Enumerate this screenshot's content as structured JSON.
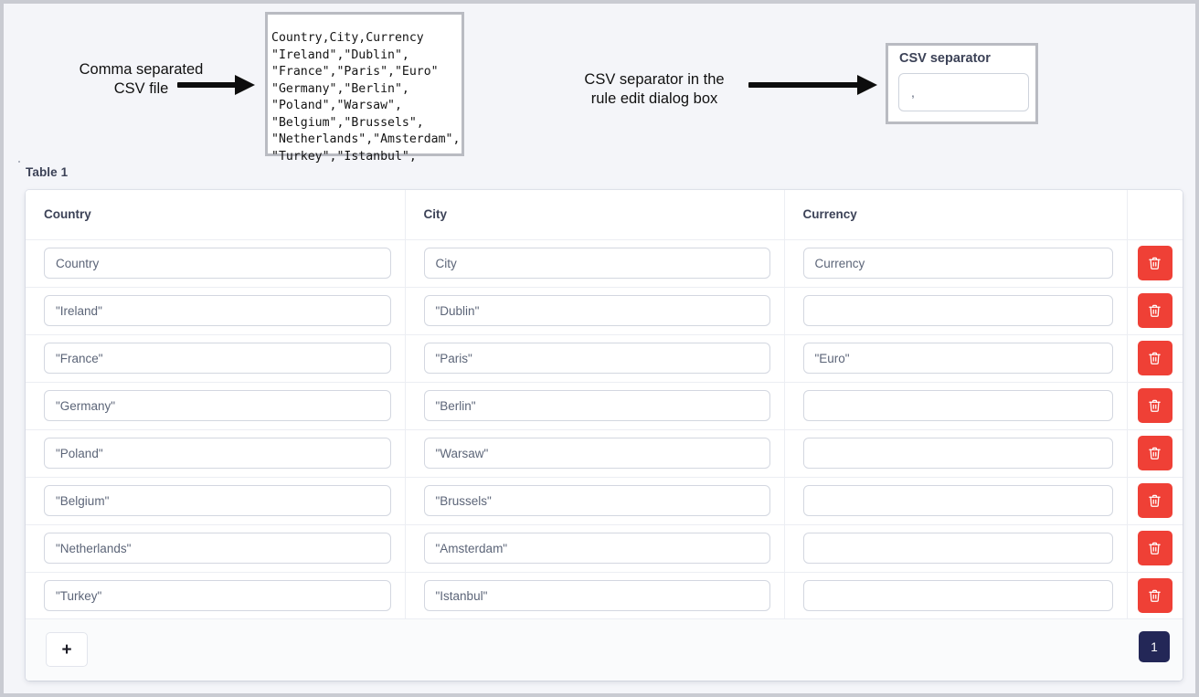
{
  "annotations": {
    "csv_file_label": "Comma separated\nCSV file",
    "separator_label": "CSV separator in the\nrule edit dialog box"
  },
  "csv_file": {
    "content": "Country,City,Currency\n\"Ireland\",\"Dublin\",\n\"France\",\"Paris\",\"Euro\"\n\"Germany\",\"Berlin\",\n\"Poland\",\"Warsaw\",\n\"Belgium\",\"Brussels\",\n\"Netherlands\",\"Amsterdam\",\n\"Turkey\",\"Istanbul\","
  },
  "separator_dialog": {
    "title": "CSV separator",
    "value": ","
  },
  "table": {
    "title": "Table 1",
    "columns": [
      "Country",
      "City",
      "Currency",
      ""
    ],
    "rows": [
      {
        "country": "Country",
        "city": "City",
        "currency": "Currency",
        "delete_label": "delete-row"
      },
      {
        "country": "\"Ireland\"",
        "city": "\"Dublin\"",
        "currency": "",
        "delete_label": "delete-row"
      },
      {
        "country": "\"France\"",
        "city": "\"Paris\"",
        "currency": "\"Euro\"",
        "delete_label": "delete-row"
      },
      {
        "country": "\"Germany\"",
        "city": "\"Berlin\"",
        "currency": "",
        "delete_label": "delete-row"
      },
      {
        "country": "\"Poland\"",
        "city": "\"Warsaw\"",
        "currency": "",
        "delete_label": "delete-row"
      },
      {
        "country": "\"Belgium\"",
        "city": "\"Brussels\"",
        "currency": "",
        "delete_label": "delete-row"
      },
      {
        "country": "\"Netherlands\"",
        "city": "\"Amsterdam\"",
        "currency": "",
        "delete_label": "delete-row"
      },
      {
        "country": "\"Turkey\"",
        "city": "\"Istanbul\"",
        "currency": "",
        "delete_label": "delete-row"
      }
    ],
    "footer": {
      "add_row_label": "+",
      "page_label": "1"
    }
  },
  "colors": {
    "delete_button": "#ef4036",
    "pagination_active": "#232757",
    "page_background": "#f4f5f9",
    "card_background": "#ffffff"
  }
}
